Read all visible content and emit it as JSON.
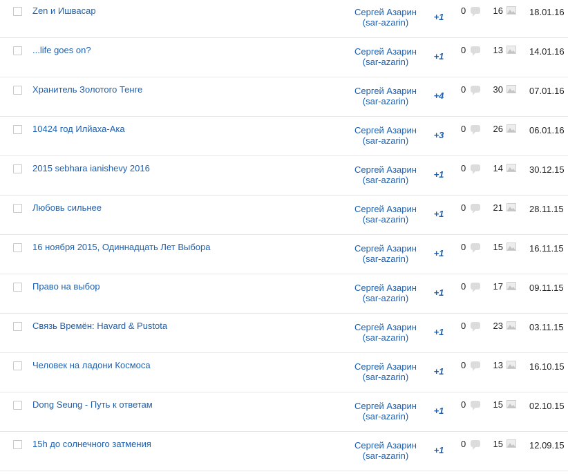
{
  "author": {
    "name": "Сергей Азарин",
    "login": "(sar-azarin)"
  },
  "icons": {
    "comment": "comment-bubble-icon",
    "photo": "image-icon",
    "checkbox": "checkbox"
  },
  "posts": [
    {
      "title": "Zen и Ишвасар",
      "rating": "+1",
      "comments": "0",
      "photos": "16",
      "date": "18.01.16"
    },
    {
      "title": "...life goes on?",
      "rating": "+1",
      "comments": "0",
      "photos": "13",
      "date": "14.01.16"
    },
    {
      "title": "Хранитель Золотого Тенге",
      "rating": "+4",
      "comments": "0",
      "photos": "30",
      "date": "07.01.16"
    },
    {
      "title": "10424 год Илйаха-Ака",
      "rating": "+3",
      "comments": "0",
      "photos": "26",
      "date": "06.01.16"
    },
    {
      "title": "2015 sebhara ianishevy 2016",
      "rating": "+1",
      "comments": "0",
      "photos": "14",
      "date": "30.12.15"
    },
    {
      "title": "Любовь сильнее",
      "rating": "+1",
      "comments": "0",
      "photos": "21",
      "date": "28.11.15"
    },
    {
      "title": "16 ноября 2015, Одиннадцать Лет Выбора",
      "rating": "+1",
      "comments": "0",
      "photos": "15",
      "date": "16.11.15"
    },
    {
      "title": "Право на выбор",
      "rating": "+1",
      "comments": "0",
      "photos": "17",
      "date": "09.11.15"
    },
    {
      "title": "Связь Времён: Havard & Pustota",
      "rating": "+1",
      "comments": "0",
      "photos": "23",
      "date": "03.11.15"
    },
    {
      "title": "Человек на ладони Космоса",
      "rating": "+1",
      "comments": "0",
      "photos": "13",
      "date": "16.10.15"
    },
    {
      "title": "Dong Seung - Путь к ответам",
      "rating": "+1",
      "comments": "0",
      "photos": "15",
      "date": "02.10.15"
    },
    {
      "title": "15h до солнечного затмения",
      "rating": "+1",
      "comments": "0",
      "photos": "15",
      "date": "12.09.15"
    }
  ]
}
